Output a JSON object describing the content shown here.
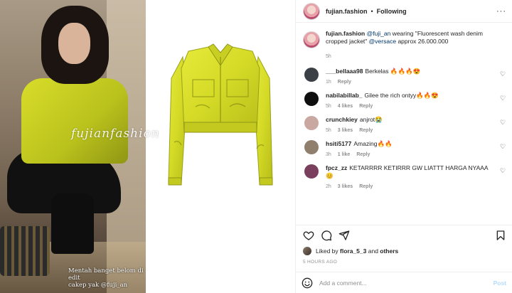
{
  "post": {
    "username": "fujian.fashion",
    "follow_status": "Following",
    "more_icon": "more-horizontal-icon"
  },
  "caption": {
    "username": "fujian.fashion",
    "mention": "@fuji_an",
    "text": " wearing \"Fluorescent wash denim cropped jacket\" ",
    "brand_mention": "@versace",
    "tail": " approx 26.000.000",
    "time": "5h"
  },
  "media": {
    "watermark": "fujianfashion",
    "overlay_line1": "Mentah banget belom di edit",
    "overlay_line2": "cakep yak @fuji_an"
  },
  "comments": [
    {
      "username": "___bellaaa98",
      "text": "Berkelas 🔥🔥🔥😍",
      "time": "1h",
      "likes": "",
      "reply": "Reply",
      "avatar_color": "#3b3f46"
    },
    {
      "username": "nabilabillab_",
      "text": "Gilee the rich ontyy🔥🔥😍",
      "time": "5h",
      "likes": "4 likes",
      "reply": "Reply",
      "avatar_color": "#0f0f0f"
    },
    {
      "username": "crunchkiey",
      "text": "anjrot😭",
      "time": "5h",
      "likes": "3 likes",
      "reply": "Reply",
      "avatar_color": "#c8a8a0"
    },
    {
      "username": "hsiti5177",
      "text": "Amazing🔥🔥",
      "time": "3h",
      "likes": "1 like",
      "reply": "Reply",
      "avatar_color": "#8f7f6c"
    },
    {
      "username": "fpcz_zz",
      "text": "KETARRRR KETIRRR GW LIATTT HARGA NYAAA😊",
      "time": "2h",
      "likes": "3 likes",
      "reply": "Reply",
      "avatar_color": "#7a3f5c"
    }
  ],
  "likes_bar": {
    "prefix": "Liked by ",
    "liker": "flora_5_3",
    "middle": " and ",
    "others": "others"
  },
  "timestamp": "5 HOURS AGO",
  "add_comment": {
    "placeholder": "Add a comment...",
    "post_label": "Post"
  },
  "colors": {
    "text": "#262626",
    "secondary": "#8e8e8e",
    "link": "#00376b",
    "post_disabled": "#b3dbff",
    "jacket": "#d9dd2a"
  }
}
